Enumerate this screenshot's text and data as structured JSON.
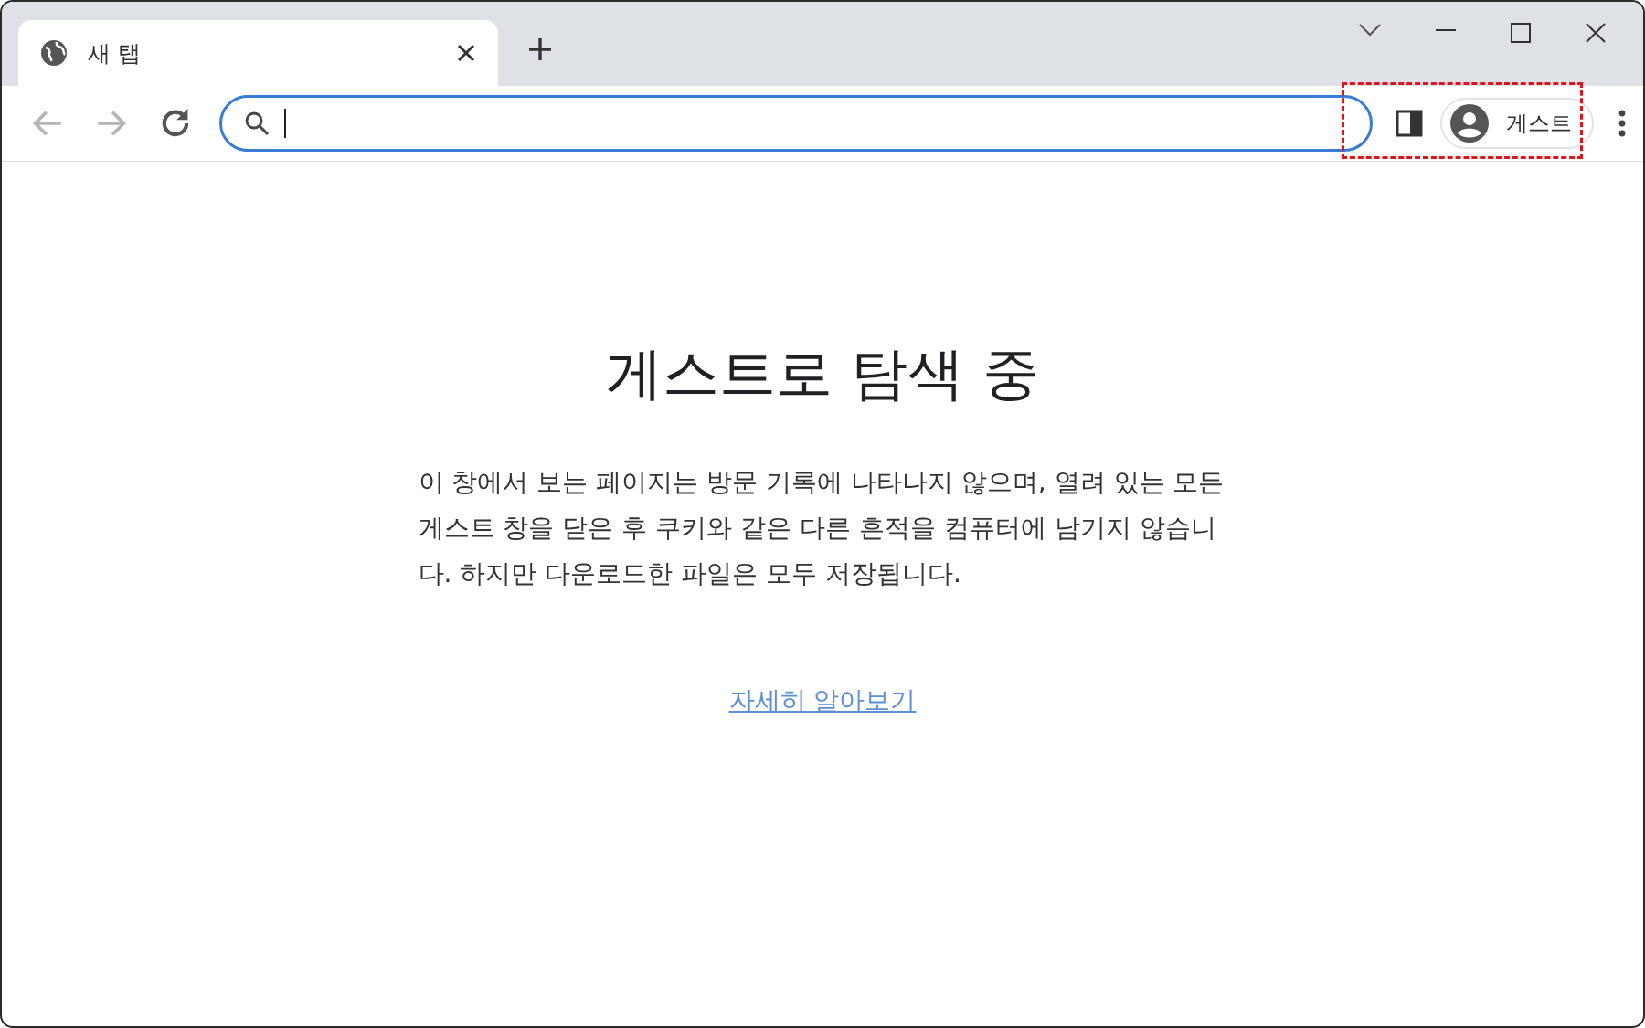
{
  "tabs": [
    {
      "title": "새 탭",
      "selected": true
    }
  ],
  "toolbar": {
    "nav": [
      {
        "kind": "back",
        "disabled": true
      },
      {
        "kind": "forward",
        "disabled": true
      },
      {
        "kind": "reload",
        "disabled": false
      }
    ],
    "address_focused": true,
    "profile": {
      "label": "게스트"
    },
    "highlighted": true
  },
  "page": {
    "heading": "게스트로 탐색 중",
    "body": "이 창에서 보는 페이지는 방문 기록에 나타나지 않으며, 열려 있는 모든 게스트 창을 닫은 후 쿠키와 같은 다른 흔적을 컴퓨터에 남기지 않습니다. 하지만 다운로드한 파일은 모두 저장됩니다.",
    "link": "자세히 알아보기"
  }
}
